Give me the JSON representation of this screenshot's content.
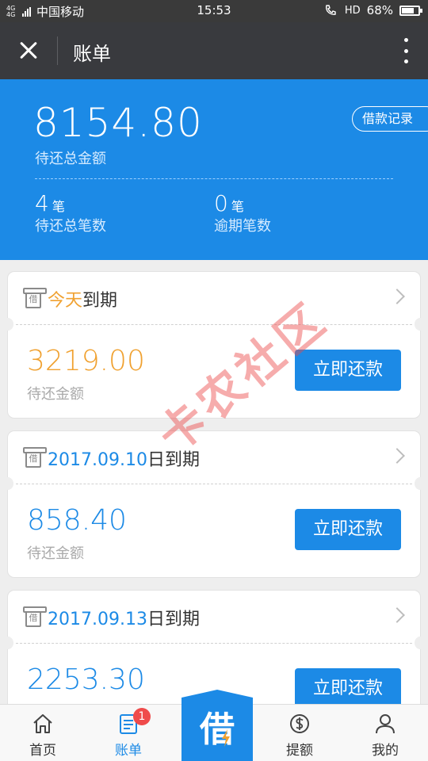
{
  "status_bar": {
    "network": "4G 4G",
    "carrier": "中国移动",
    "time": "15:53",
    "hd_label": "HD",
    "battery": "68%",
    "battery_level": 0.68
  },
  "title_bar": {
    "title": "账单"
  },
  "summary": {
    "total_amount": "8154.80",
    "total_label": "待还总金额",
    "history_button": "借款记录",
    "pending_count": "4",
    "pending_unit": "笔",
    "pending_label": "待还总笔数",
    "overdue_count": "0",
    "overdue_unit": "笔",
    "overdue_label": "逾期笔数"
  },
  "bills": [
    {
      "icon_text": "借",
      "due_highlight": "今天",
      "due_suffix": "到期",
      "amount": "3219.00",
      "amount_label": "待还金额",
      "button": "立即还款"
    },
    {
      "icon_text": "借",
      "due_highlight": "2017.09.10",
      "due_suffix": "日到期",
      "amount": "858.40",
      "amount_label": "待还金额",
      "button": "立即还款"
    },
    {
      "icon_text": "借",
      "due_highlight": "2017.09.13",
      "due_suffix": "日到期",
      "amount": "2253.30",
      "button": "立即还款"
    }
  ],
  "watermark": "卡农社区",
  "tab_bar": {
    "home": "首页",
    "bills": "账单",
    "bills_badge": "1",
    "borrow": "借",
    "quota": "提额",
    "mine": "我的"
  },
  "colors": {
    "primary": "#1c8ae6",
    "orange": "#f0a130",
    "header_dark": "#393a3e",
    "badge_red": "#ef4b4b"
  },
  "icons": [
    "close-icon",
    "more-icon",
    "date-icon",
    "chevron-right-icon",
    "home-icon",
    "bill-list-icon",
    "dollar-icon",
    "person-icon"
  ]
}
